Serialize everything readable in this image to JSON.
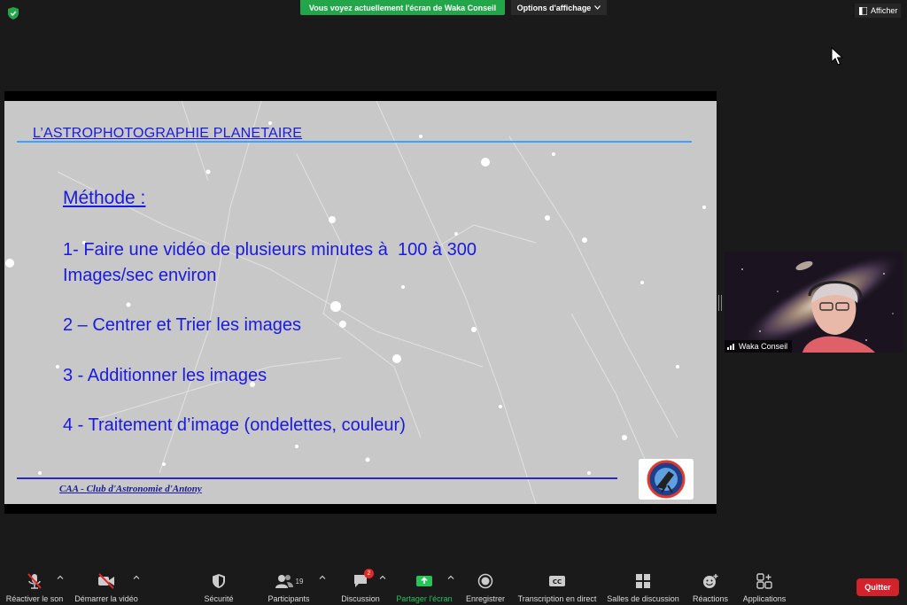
{
  "top_bar": {
    "share_banner": "Vous voyez actuellement l'écran de Waka Conseil",
    "view_options": "Options d'affichage",
    "show_button": "Afficher"
  },
  "slide": {
    "title": "L’ASTROPHOTOGRAPHIE PLANETAIRE",
    "heading": "Méthode :",
    "items": [
      "1- Faire une vidéo de plusieurs minutes à  100 à 300",
      "Images/sec environ",
      "2 – Centrer et Trier les images",
      "3 - Additionner les images",
      "4 - Traitement d’image (ondelettes, couleur)"
    ],
    "footer": "CAA - Club d'Astronomie d'Antony"
  },
  "video": {
    "participant_name": "Waka Conseil"
  },
  "toolbar": {
    "unmute": "Réactiver le son",
    "start_video": "Démarrer la vidéo",
    "security": "Sécurité",
    "participants": "Participants",
    "participants_count": "19",
    "chat": "Discussion",
    "chat_badge": "2",
    "share_screen": "Partager l'écran",
    "record": "Enregistrer",
    "transcription": "Transcription en direct",
    "breakout_rooms": "Salles de discussion",
    "reactions": "Réactions",
    "apps": "Applications",
    "quit": "Quitter"
  },
  "colors": {
    "share_green": "#23a54a",
    "slide_text_blue": "#1a1adf",
    "quit_red": "#d2232a"
  }
}
